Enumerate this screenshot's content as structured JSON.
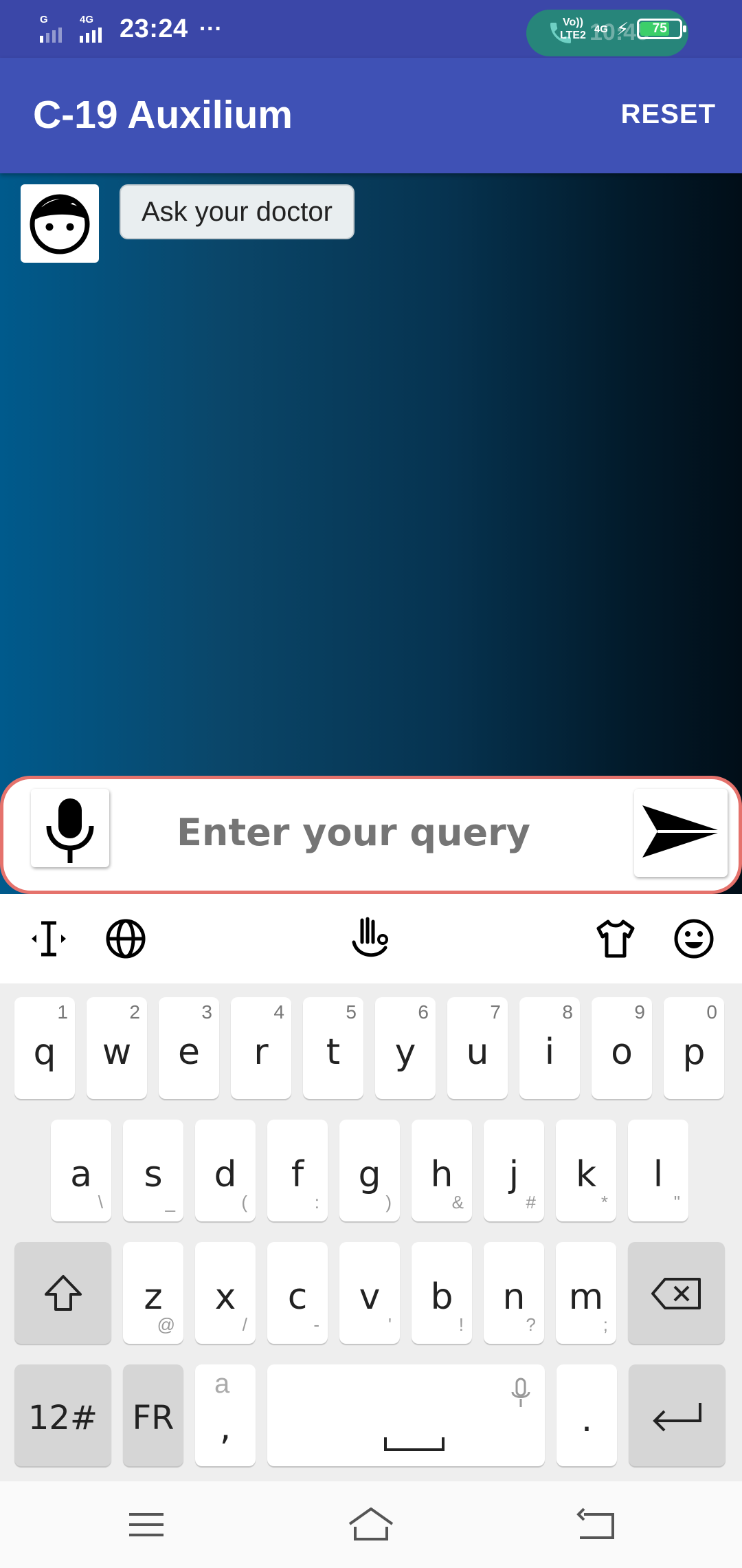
{
  "status_bar": {
    "sim1_network": "G",
    "sim2_network": "4G",
    "time": "23:24",
    "more_indicator": "···",
    "volte_top": "Vo))",
    "volte_bottom": "LTE2",
    "data_network": "4G",
    "battery_level": "75",
    "call_duration_faded": "10:45",
    "battery_color": "#3ccf6a"
  },
  "app_bar": {
    "title": "C-19 Auxilium",
    "reset_label": "RESET",
    "color": "#3f51b5"
  },
  "chat": {
    "avatar_icon": "face-icon",
    "messages": [
      {
        "text": "Ask your doctor"
      }
    ]
  },
  "composer": {
    "placeholder": "Enter your query",
    "mic_icon": "microphone-icon",
    "send_icon": "send-arrow-icon",
    "border_color": "#e5726c"
  },
  "keyboard_toolbar": {
    "icons": [
      "text-cursor-icon",
      "globe-icon",
      "gesture-hand-icon",
      "theme-shirt-icon",
      "emoji-icon"
    ]
  },
  "keyboard": {
    "row1": [
      {
        "key": "q",
        "hint": "1"
      },
      {
        "key": "w",
        "hint": "2"
      },
      {
        "key": "e",
        "hint": "3"
      },
      {
        "key": "r",
        "hint": "4"
      },
      {
        "key": "t",
        "hint": "5"
      },
      {
        "key": "y",
        "hint": "6"
      },
      {
        "key": "u",
        "hint": "7"
      },
      {
        "key": "i",
        "hint": "8"
      },
      {
        "key": "o",
        "hint": "9"
      },
      {
        "key": "p",
        "hint": "0"
      }
    ],
    "row2": [
      {
        "key": "a",
        "sub": "\\"
      },
      {
        "key": "s",
        "sub": "_"
      },
      {
        "key": "d",
        "sub": "("
      },
      {
        "key": "f",
        "sub": ":"
      },
      {
        "key": "g",
        "sub": ")"
      },
      {
        "key": "h",
        "sub": "&"
      },
      {
        "key": "j",
        "sub": "#"
      },
      {
        "key": "k",
        "sub": "*"
      },
      {
        "key": "l",
        "sub": "\""
      }
    ],
    "row3": [
      {
        "key": "z",
        "sub": "@"
      },
      {
        "key": "x",
        "sub": "/"
      },
      {
        "key": "c",
        "sub": "-"
      },
      {
        "key": "v",
        "sub": "'"
      },
      {
        "key": "b",
        "sub": "!"
      },
      {
        "key": "n",
        "sub": "?"
      },
      {
        "key": "m",
        "sub": ";"
      }
    ],
    "shift_icon": "shift-arrow-icon",
    "backspace_icon": "backspace-icon",
    "symbols_label": "12#",
    "language_label": "FR",
    "comma_label": ",",
    "comma_hint": "a",
    "space_icon": "spacebar-icon",
    "period_label": ".",
    "enter_icon": "enter-arrow-icon"
  },
  "nav_bar": {
    "icons": [
      "menu-lines-icon",
      "home-icon",
      "back-icon"
    ]
  }
}
